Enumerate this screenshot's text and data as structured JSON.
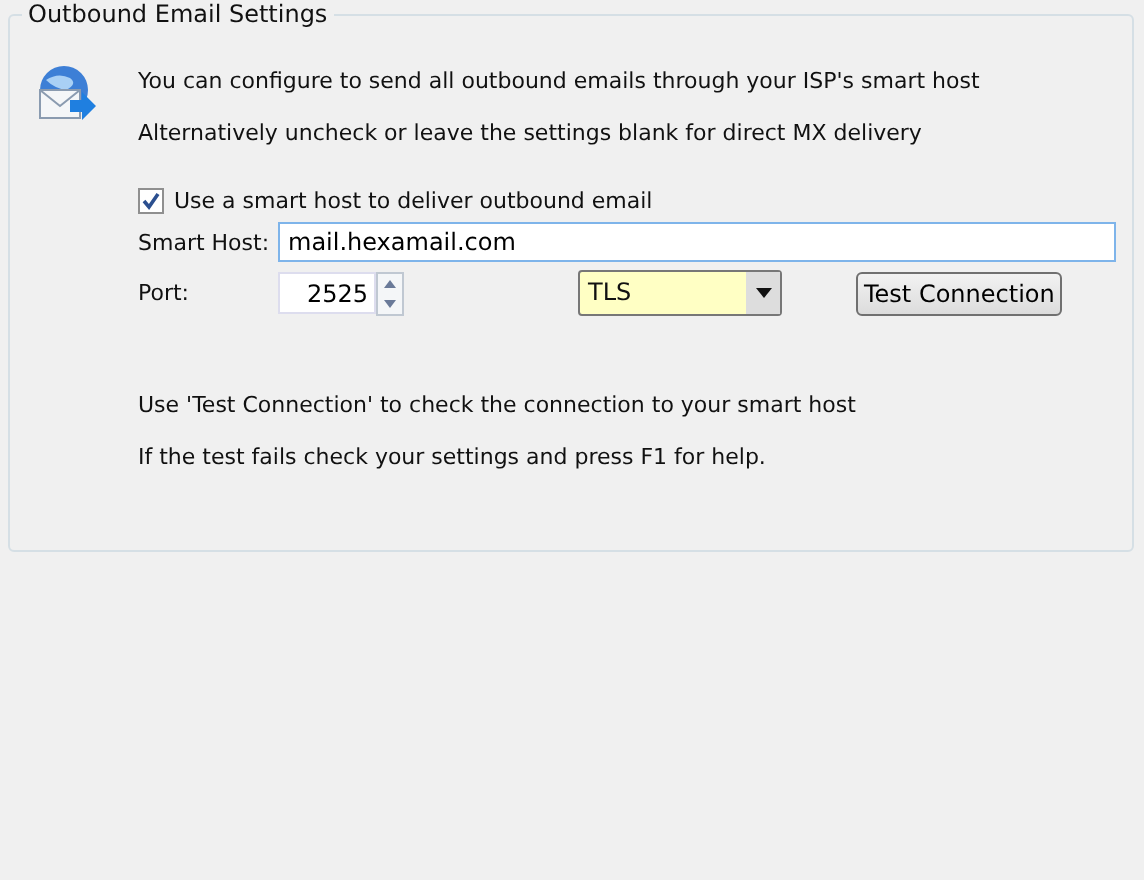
{
  "group": {
    "title": "Outbound Email Settings"
  },
  "intro": [
    "You can configure to send all outbound emails through your ISP's smart host",
    "Alternatively uncheck or leave the settings blank for direct MX delivery"
  ],
  "smart_host_option": {
    "label": "Use a smart host to deliver outbound email",
    "checked": true
  },
  "smart_host": {
    "label": "Smart Host:",
    "value": "mail.hexamail.com"
  },
  "port": {
    "label": "Port:",
    "value": "2525"
  },
  "security": {
    "value": "TLS"
  },
  "test_button": "Test Connection",
  "notes": [
    "Use 'Test Connection' to check the connection to your smart host",
    "If the test fails check your settings and press F1 for help."
  ]
}
